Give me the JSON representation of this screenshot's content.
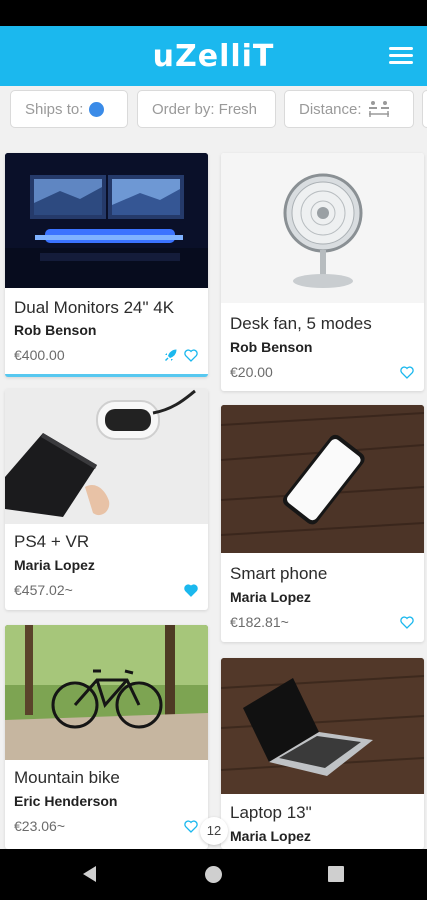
{
  "app": {
    "logo": "uZelliT",
    "accent_color": "#1bb8ee"
  },
  "filters": [
    {
      "label": "Ships to:",
      "icon": "globe-icon"
    },
    {
      "label": "Order by: Fresh"
    },
    {
      "label": "Distance:",
      "icon": "distance-icon"
    }
  ],
  "listings": [
    {
      "title": "Dual Monitors 24\" 4K",
      "seller": "Rob Benson",
      "price": "€400.00",
      "favorited": false,
      "boosted": true
    },
    {
      "title": "Desk fan, 5 modes",
      "seller": "Rob Benson",
      "price": "€20.00",
      "favorited": false
    },
    {
      "title": "PS4 + VR",
      "seller": "Maria Lopez",
      "price": "€457.02~",
      "favorited": true
    },
    {
      "title": "Smart phone",
      "seller": "Maria Lopez",
      "price": "€182.81~",
      "favorited": false
    },
    {
      "title": "Mountain bike",
      "seller": "Eric Henderson",
      "price": "€23.06~",
      "favorited": false
    },
    {
      "title": "Laptop 13\"",
      "seller": "Maria Lopez",
      "price": ""
    }
  ],
  "page_indicator": "12",
  "nav": {
    "back": "back-icon",
    "home": "home-icon",
    "recent": "recent-apps-icon"
  }
}
